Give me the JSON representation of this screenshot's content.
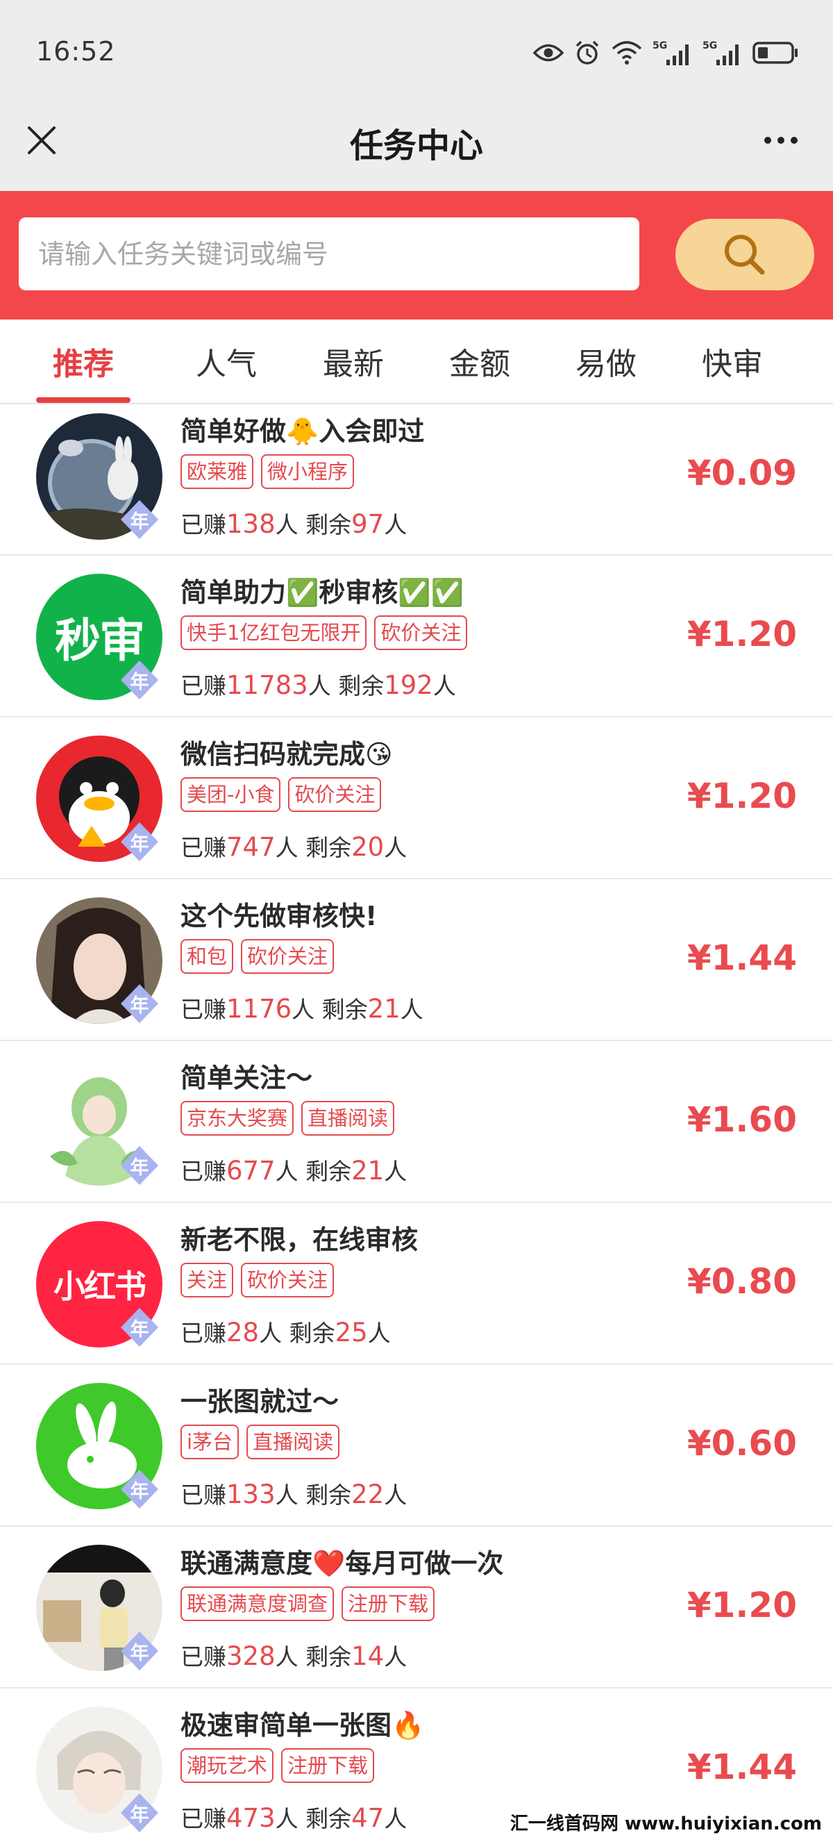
{
  "status_bar": {
    "time": "16:52",
    "network_1": "5G",
    "network_2": "5G"
  },
  "nav": {
    "title": "任务中心"
  },
  "search": {
    "placeholder": "请输入任务关键词或编号"
  },
  "tabs": [
    "推荐",
    "人气",
    "最新",
    "金额",
    "易做",
    "快审"
  ],
  "active_tab": "推荐",
  "year_badge": "年",
  "stats_labels": {
    "earned": "已赚",
    "remaining": "剩余",
    "unit": "人"
  },
  "items": [
    {
      "title": "简单好做🐥入会即过",
      "tags": [
        "欧莱雅",
        "微小程序"
      ],
      "earned": "138",
      "remaining": "97",
      "price": "¥0.09"
    },
    {
      "title": "简单助力✅秒审核✅✅",
      "tags": [
        "快手1亿红包无限开",
        "砍价关注"
      ],
      "earned": "11783",
      "remaining": "192",
      "price": "¥1.20",
      "avatar_text": "秒审"
    },
    {
      "title": "微信扫码就完成😘",
      "tags": [
        "美团-小食",
        "砍价关注"
      ],
      "earned": "747",
      "remaining": "20",
      "price": "¥1.20"
    },
    {
      "title": "这个先做审核快!",
      "tags": [
        "和包",
        "砍价关注"
      ],
      "earned": "1176",
      "remaining": "21",
      "price": "¥1.44"
    },
    {
      "title": "简单关注～",
      "tags": [
        "京东大奖赛",
        "直播阅读"
      ],
      "earned": "677",
      "remaining": "21",
      "price": "¥1.60"
    },
    {
      "title": "新老不限，在线审核",
      "tags": [
        "关注",
        "砍价关注"
      ],
      "earned": "28",
      "remaining": "25",
      "price": "¥0.80",
      "avatar_text": "小红书"
    },
    {
      "title": "一张图就过～",
      "tags": [
        "i茅台",
        "直播阅读"
      ],
      "earned": "133",
      "remaining": "22",
      "price": "¥0.60"
    },
    {
      "title": "联通满意度❤️每月可做一次",
      "tags": [
        "联通满意度调查",
        "注册下载"
      ],
      "earned": "328",
      "remaining": "14",
      "price": "¥1.20"
    },
    {
      "title": "极速审简单一张图🔥",
      "tags": [
        "潮玩艺术",
        "注册下载"
      ],
      "earned": "473",
      "remaining": "47",
      "price": "¥1.44"
    }
  ],
  "watermark": "汇一线首码网 www.huiyixian.com",
  "colors": {
    "brand_red": "#f4474c",
    "accent_red": "#e94b4f",
    "search_button": "#f7d596",
    "badge": "#a9b3f0"
  }
}
